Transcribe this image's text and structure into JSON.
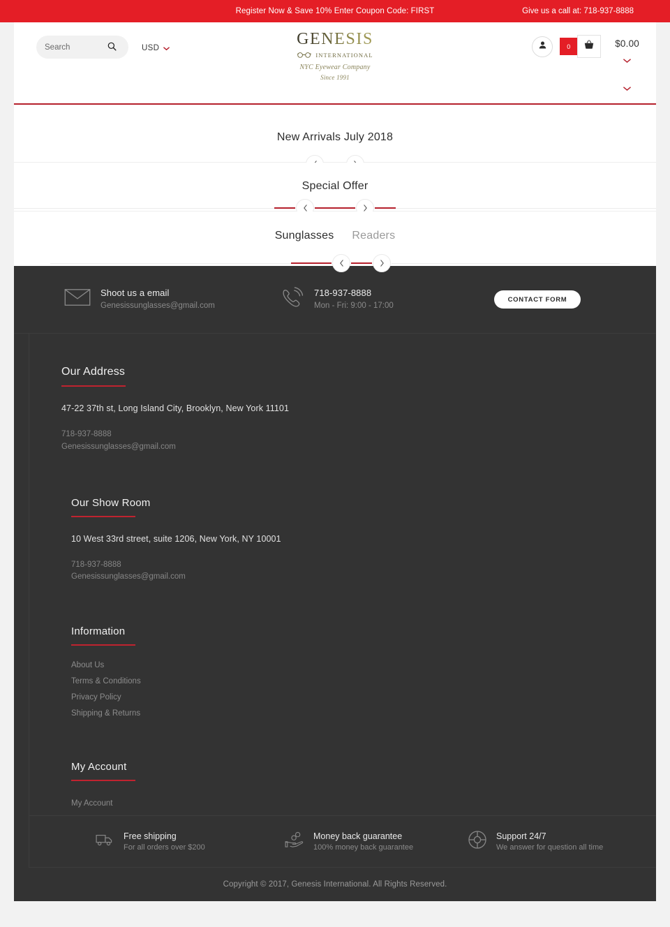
{
  "promo": {
    "offer_text": "Register Now & Save 10% Enter Coupon Code: FIRST",
    "call_text": "Give us a call at: 718-937-8888",
    "bg_color": "#e41e26"
  },
  "header": {
    "search": {
      "placeholder": "Search",
      "value": "",
      "icon": "search-icon"
    },
    "currency": {
      "selected": "USD",
      "options": [
        "USD"
      ],
      "icon": "chevron-down-icon"
    },
    "logo": {
      "main": "GENESIS",
      "sub": "INTERNATIONAL",
      "script_line1": "NYC Eyewear Company",
      "script_line2": "Since 1991",
      "glasses_icon": "glasses-icon"
    },
    "account": {
      "icon": "user-icon"
    },
    "cart": {
      "count": "0",
      "icon": "basket-icon",
      "total": "$0.00",
      "chevron_icon": "chevron-down-icon"
    },
    "accent_line_color": "#b5202c"
  },
  "sections": [
    {
      "title": "New Arrivals July 2018",
      "prev_icon": "chevron-left-icon",
      "next_icon": "chevron-right-icon"
    },
    {
      "title": "Special Offer",
      "prev_icon": "chevron-left-icon",
      "next_icon": "chevron-right-icon"
    }
  ],
  "tabs_section": {
    "tabs": [
      {
        "label": "Sunglasses",
        "active": true
      },
      {
        "label": "Readers",
        "active": false
      }
    ],
    "prev_icon": "chevron-left-icon",
    "next_icon": "chevron-right-icon"
  },
  "footer": {
    "contact": {
      "email_block": {
        "icon": "envelope-icon",
        "title": "Shoot us a email",
        "value": "Genesissunglasses@gmail.com"
      },
      "phone_block": {
        "icon": "phone-icon",
        "title": "718-937-8888",
        "value": "Mon - Fri: 9:00 - 17:00"
      },
      "contact_form_button": "CONTACT FORM"
    },
    "address": {
      "heading": "Our Address",
      "line": "47-22 37th st, Long Island City, Brooklyn, New York 11101",
      "phone": "718-937-8888",
      "email": "Genesissunglasses@gmail.com"
    },
    "showroom": {
      "heading": "Our Show Room",
      "line": "10 West 33rd street, suite 1206, New York, NY 10001",
      "phone": "718-937-8888",
      "email": "Genesissunglasses@gmail.com"
    },
    "information": {
      "heading": "Information",
      "links": [
        "About Us",
        "Terms & Conditions",
        "Privacy Policy",
        "Shipping & Returns"
      ]
    },
    "my_account": {
      "heading": "My Account",
      "links": [
        "My Account"
      ]
    },
    "features": [
      {
        "icon": "truck-icon",
        "title": "Free shipping",
        "subtitle": "For all orders over $200"
      },
      {
        "icon": "hand-coins-icon",
        "title": "Money back guarantee",
        "subtitle": "100% money back guarantee"
      },
      {
        "icon": "lifebuoy-icon",
        "title": "Support 24/7",
        "subtitle": "We answer for question all time"
      }
    ],
    "copyright": "Copyright © 2017, Genesis International. All Rights Reserved.",
    "bg_color": "#333333",
    "accent_color": "#c0232f"
  }
}
